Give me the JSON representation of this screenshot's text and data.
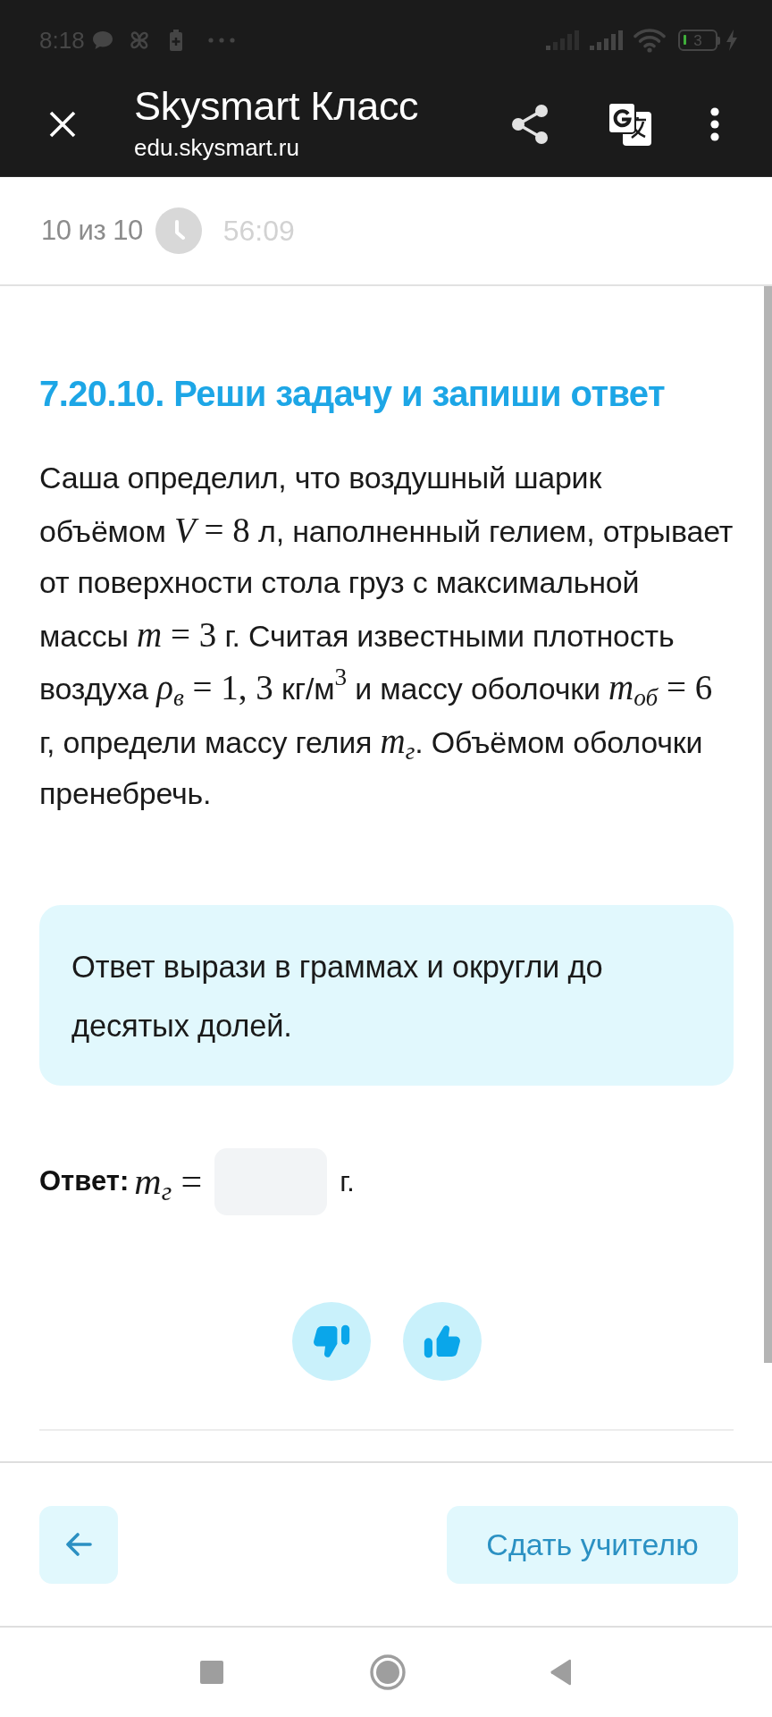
{
  "status_bar": {
    "time": "8:18",
    "battery": "3"
  },
  "app_bar": {
    "title": "Skysmart Класс",
    "url": "edu.skysmart.ru"
  },
  "progress": {
    "counter": "10 из 10",
    "timer": "56:09"
  },
  "task": {
    "title": "7.20.10. Реши задачу и запиши ответ",
    "text": [
      {
        "kind": "text",
        "text": "Саша определил, что воздушный шарик объёмом "
      },
      {
        "kind": "math",
        "text": "*V* = 8"
      },
      {
        "kind": "text",
        "text": " л, наполненный гелием, отрывает от поверхности стола груз с максимальной массы "
      },
      {
        "kind": "math",
        "text": "*m* = 3"
      },
      {
        "kind": "text",
        "text": " г. Считая известными плотность воздуха "
      },
      {
        "kind": "math",
        "text": "*ρ*$_{в}$ = 1, 3"
      },
      {
        "kind": "text",
        "text": " кг/м"
      },
      {
        "kind": "math",
        "text": "$^{3}$"
      },
      {
        "kind": "text",
        "text": " и массу оболочки "
      },
      {
        "kind": "math",
        "text": "*m*$_{об}$ = 6"
      },
      {
        "kind": "text",
        "text": " г, определи массу гелия "
      },
      {
        "kind": "math",
        "text": "*m*$_{г}$"
      },
      {
        "kind": "text",
        "text": ". Объёмом оболочки пренебречь."
      }
    ],
    "hint": "Ответ вырази в граммах и округли до десятых долей.",
    "answer": {
      "label": "Ответ:",
      "formula": "*m*$_{г}$ =",
      "unit": "г."
    }
  },
  "feedback": [
    {
      "kind": "dislike"
    },
    {
      "kind": "like"
    }
  ],
  "footer": {
    "submit": "Сдать учителю"
  }
}
